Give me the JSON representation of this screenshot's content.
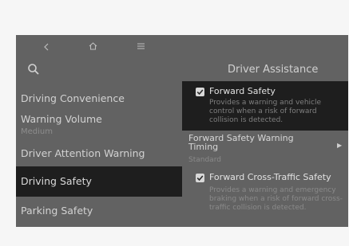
{
  "nav": {
    "back_icon": "chevron-left-icon",
    "home_icon": "home-icon",
    "menu_icon": "menu-icon",
    "search_icon": "search-icon"
  },
  "left_menu": {
    "items": [
      {
        "label": "Driving Convenience"
      },
      {
        "label": "Warning Volume",
        "sub": "Medium"
      },
      {
        "label": "Driver Attention Warning"
      },
      {
        "label": "Driving Safety",
        "selected": true
      },
      {
        "label": "Parking Safety"
      }
    ]
  },
  "panel": {
    "title": "Driver Assistance",
    "options": [
      {
        "label": "Forward Safety",
        "checked": true,
        "description": "Provides a warning and vehicle control when a risk of forward collision is detected."
      },
      {
        "label": "Forward Safety Warning Timing",
        "value": "Standard"
      },
      {
        "label": "Forward Cross-Traffic Safety",
        "checked": true,
        "description": "Provides a warning and emergency braking when a risk of forward cross-traffic collision is detected."
      }
    ]
  },
  "colors": {
    "screen_bg": "#626262",
    "selected_bg": "#1e1e1e",
    "text_primary": "#e2e2e2",
    "text_secondary": "#8a8a8a"
  }
}
